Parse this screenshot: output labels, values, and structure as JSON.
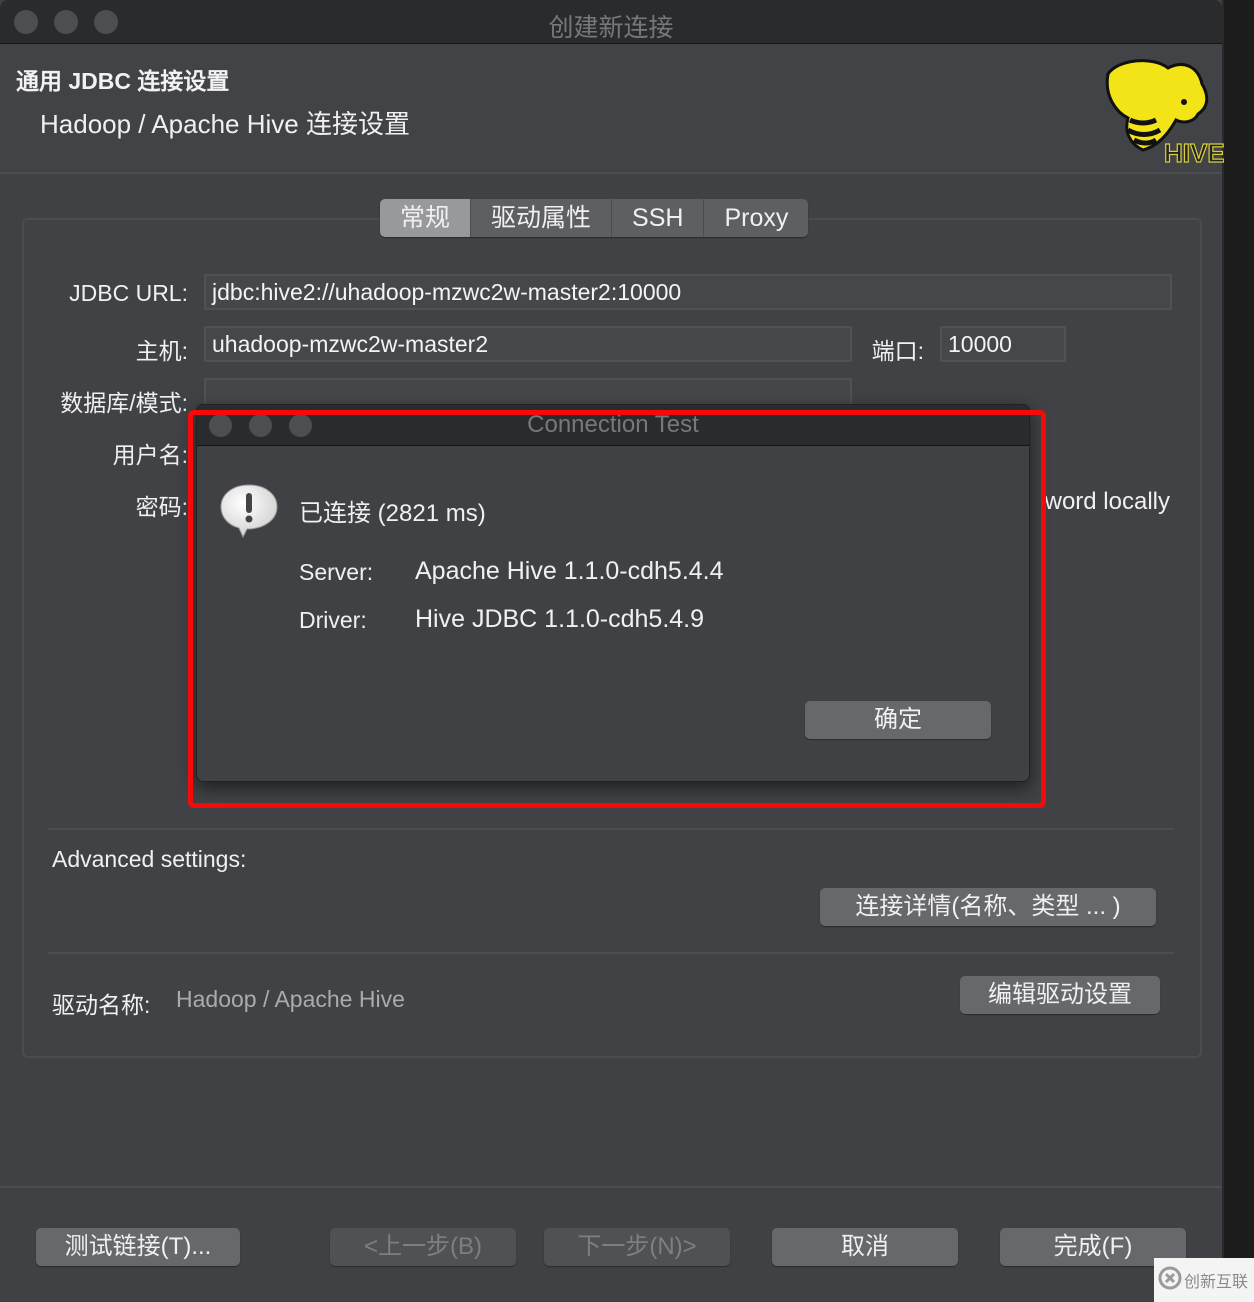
{
  "window": {
    "title": "创建新连接"
  },
  "header": {
    "title": "通用 JDBC 连接设置",
    "subtitle": "Hadoop / Apache Hive 连接设置",
    "logo_text": "HIVE",
    "logo_icon": "hive-elephant-bee-logo"
  },
  "tabs": [
    {
      "label": "常规",
      "active": true
    },
    {
      "label": "驱动属性",
      "active": false
    },
    {
      "label": "SSH",
      "active": false
    },
    {
      "label": "Proxy",
      "active": false
    }
  ],
  "form": {
    "jdbc_url": {
      "label": "JDBC URL:",
      "value": "jdbc:hive2://uhadoop-mzwc2w-master2:10000"
    },
    "host": {
      "label": "主机:",
      "value": "uhadoop-mzwc2w-master2"
    },
    "port": {
      "label": "端口:",
      "value": "10000"
    },
    "database": {
      "label": "数据库/模式:",
      "value": ""
    },
    "username": {
      "label": "用户名:"
    },
    "password": {
      "label": "密码:"
    },
    "save_password_partial": "word locally"
  },
  "advanced": {
    "label": "Advanced settings:",
    "details_button": "连接详情(名称、类型 ... )"
  },
  "driver": {
    "label": "驱动名称:",
    "value": "Hadoop / Apache Hive",
    "edit_button": "编辑驱动设置"
  },
  "footer": {
    "test_button": "测试链接(T)...",
    "back_button": "<上一步(B)",
    "next_button": "下一步(N)>",
    "cancel_button": "取消",
    "finish_button": "完成(F)"
  },
  "dialog": {
    "title": "Connection Test",
    "icon": "alert-speech-bubble-icon",
    "status": "已连接 (2821 ms)",
    "server_label": "Server:",
    "server_value": "Apache Hive 1.1.0-cdh5.4.4",
    "driver_label": "Driver:",
    "driver_value": "Hive JDBC 1.1.0-cdh5.4.9",
    "ok_button": "确定"
  },
  "annotation": {
    "highlight_color": "#f40a0a"
  },
  "watermark": {
    "text": "创新互联"
  }
}
